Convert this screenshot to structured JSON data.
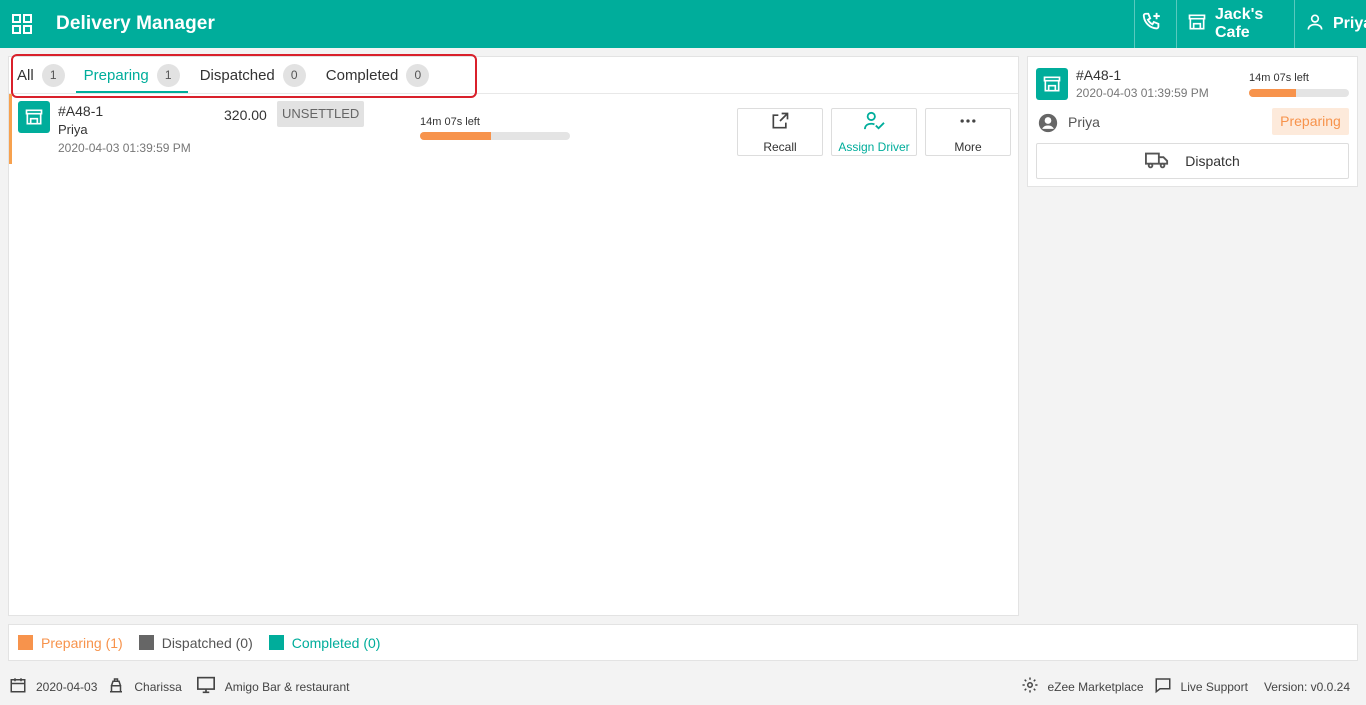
{
  "header": {
    "title": "Delivery Manager",
    "cafe": "Jack's Cafe",
    "user": "Priya"
  },
  "tabs": [
    {
      "label": "All",
      "count": "1",
      "active": false
    },
    {
      "label": "Preparing",
      "count": "1",
      "active": true
    },
    {
      "label": "Dispatched",
      "count": "0",
      "active": false
    },
    {
      "label": "Completed",
      "count": "0",
      "active": false
    }
  ],
  "order": {
    "id": "#A48-1",
    "customer": "Priya",
    "date": "2020-04-03 01:39:59 PM",
    "amount": "320.00",
    "status": "UNSETTLED",
    "time_left": "14m 07s left",
    "progress": 0.47,
    "actions": {
      "recall": "Recall",
      "assign": "Assign Driver",
      "more": "More"
    }
  },
  "side": {
    "id": "#A48-1",
    "date": "2020-04-03 01:39:59 PM",
    "time_left": "14m 07s left",
    "progress": 0.47,
    "customer": "Priya",
    "badge": "Preparing",
    "dispatch": "Dispatch"
  },
  "legend": {
    "preparing": "Preparing (1)",
    "dispatched": "Dispatched (0)",
    "completed": "Completed (0)",
    "colors": {
      "preparing": "#f7934c",
      "dispatched": "#666666",
      "completed": "#00ad9b"
    }
  },
  "footer": {
    "date": "2020-04-03",
    "waiter": "Charissa",
    "outlet": "Amigo Bar & restaurant",
    "marketplace": "eZee Marketplace",
    "support": "Live Support",
    "version": "Version: v0.0.24"
  },
  "colors": {
    "accent": "#00ad9b",
    "orange": "#f7934c"
  }
}
